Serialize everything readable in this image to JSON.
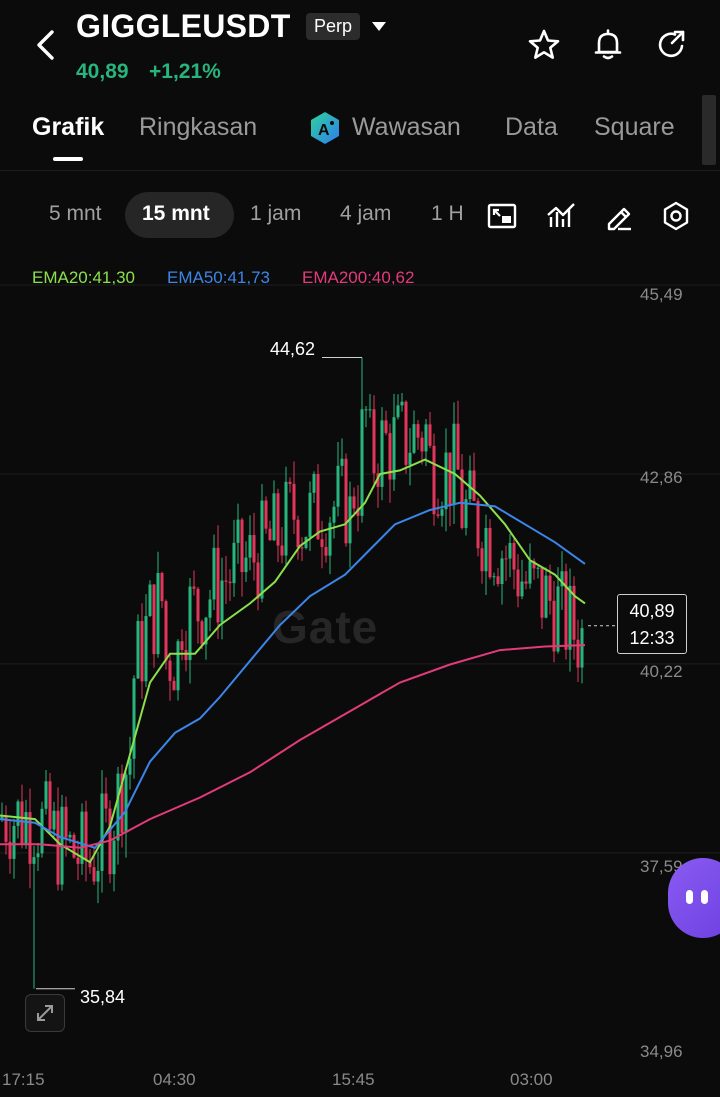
{
  "header": {
    "symbol": "GIGGLEUSDT",
    "badge": "Perp",
    "price": "40,89",
    "change": "+1,21%",
    "icons": [
      "back-arrow-icon",
      "star-icon",
      "bell-icon",
      "share-icon"
    ]
  },
  "tabs": [
    {
      "label": "Grafik",
      "active": true
    },
    {
      "label": "Ringkasan",
      "active": false
    },
    {
      "label": "Wawasan",
      "active": false,
      "icon": "ai-icon"
    },
    {
      "label": "Data",
      "active": false
    },
    {
      "label": "Square",
      "active": false
    }
  ],
  "timeframes": [
    {
      "label": "5 mnt",
      "active": false
    },
    {
      "label": "15 mnt",
      "active": true
    },
    {
      "label": "1 jam",
      "active": false
    },
    {
      "label": "4 jam",
      "active": false
    },
    {
      "label": "1 H",
      "active": false
    }
  ],
  "toolbar_icons": [
    "chart-layout-icon",
    "indicator-icon",
    "draw-icon",
    "settings-icon"
  ],
  "indicators": {
    "ema20": "EMA20:41,30",
    "ema50": "EMA50:41,73",
    "ema200": "EMA200:40,62"
  },
  "colors": {
    "up": "#27b47d",
    "down": "#e2365b",
    "ema20": "#8be04b",
    "ema50": "#3b86e8",
    "ema200": "#e23b7a"
  },
  "watermark": "Gate",
  "chart_data": {
    "type": "candlestick",
    "y_ticks": [
      "45,49",
      "42,86",
      "40,22",
      "37,59",
      "34,96"
    ],
    "ylim": [
      34.96,
      45.49
    ],
    "x_ticks": [
      "17:15",
      "04:30",
      "15:45",
      "03:00"
    ],
    "high_label": "44,62",
    "low_label": "35,84",
    "last_price": "40,89",
    "countdown": "12:33",
    "ema_series": [
      {
        "name": "EMA20",
        "points": [
          [
            0,
            38.25
          ],
          [
            35,
            38.2
          ],
          [
            60,
            37.85
          ],
          [
            90,
            37.6
          ],
          [
            110,
            38.1
          ],
          [
            130,
            39.1
          ],
          [
            150,
            40.1
          ],
          [
            170,
            40.5
          ],
          [
            195,
            40.5
          ],
          [
            220,
            40.9
          ],
          [
            250,
            41.2
          ],
          [
            275,
            41.5
          ],
          [
            300,
            42.0
          ],
          [
            320,
            42.2
          ],
          [
            345,
            42.3
          ],
          [
            365,
            42.6
          ],
          [
            380,
            43.0
          ],
          [
            400,
            43.05
          ],
          [
            425,
            43.2
          ],
          [
            455,
            43.0
          ],
          [
            480,
            42.7
          ],
          [
            505,
            42.3
          ],
          [
            530,
            41.8
          ],
          [
            555,
            41.6
          ],
          [
            575,
            41.3
          ],
          [
            585,
            41.2
          ]
        ]
      },
      {
        "name": "EMA50",
        "points": [
          [
            0,
            38.2
          ],
          [
            35,
            38.15
          ],
          [
            60,
            37.95
          ],
          [
            95,
            37.8
          ],
          [
            125,
            38.3
          ],
          [
            150,
            39.0
          ],
          [
            175,
            39.4
          ],
          [
            200,
            39.6
          ],
          [
            220,
            39.9
          ],
          [
            250,
            40.4
          ],
          [
            280,
            40.9
          ],
          [
            310,
            41.3
          ],
          [
            345,
            41.6
          ],
          [
            370,
            41.95
          ],
          [
            395,
            42.3
          ],
          [
            430,
            42.5
          ],
          [
            460,
            42.6
          ],
          [
            495,
            42.55
          ],
          [
            525,
            42.3
          ],
          [
            555,
            42.05
          ],
          [
            585,
            41.75
          ]
        ]
      },
      {
        "name": "EMA200",
        "points": [
          [
            0,
            37.85
          ],
          [
            40,
            37.85
          ],
          [
            80,
            37.8
          ],
          [
            110,
            37.9
          ],
          [
            150,
            38.2
          ],
          [
            200,
            38.5
          ],
          [
            250,
            38.85
          ],
          [
            300,
            39.3
          ],
          [
            350,
            39.7
          ],
          [
            400,
            40.1
          ],
          [
            450,
            40.35
          ],
          [
            500,
            40.55
          ],
          [
            545,
            40.6
          ],
          [
            585,
            40.62
          ]
        ]
      }
    ]
  }
}
